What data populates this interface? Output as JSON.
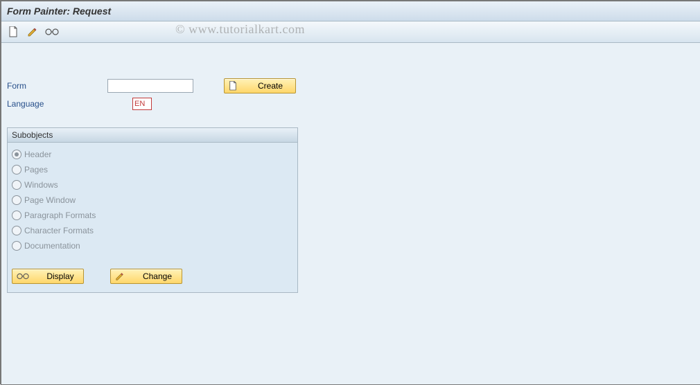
{
  "header": {
    "title": "Form Painter: Request"
  },
  "watermark": "© www.tutorialkart.com",
  "toolbar": {
    "create_tooltip": "Create",
    "change_tooltip": "Change",
    "display_tooltip": "Display"
  },
  "form": {
    "form_label": "Form",
    "form_value": "",
    "language_label": "Language",
    "language_value": "EN",
    "create_btn": "Create"
  },
  "subobjects": {
    "title": "Subobjects",
    "options": [
      {
        "label": "Header",
        "selected": true
      },
      {
        "label": "Pages",
        "selected": false
      },
      {
        "label": "Windows",
        "selected": false
      },
      {
        "label": "Page Window",
        "selected": false
      },
      {
        "label": "Paragraph Formats",
        "selected": false
      },
      {
        "label": "Character Formats",
        "selected": false
      },
      {
        "label": "Documentation",
        "selected": false
      }
    ],
    "display_btn": "Display",
    "change_btn": "Change"
  }
}
